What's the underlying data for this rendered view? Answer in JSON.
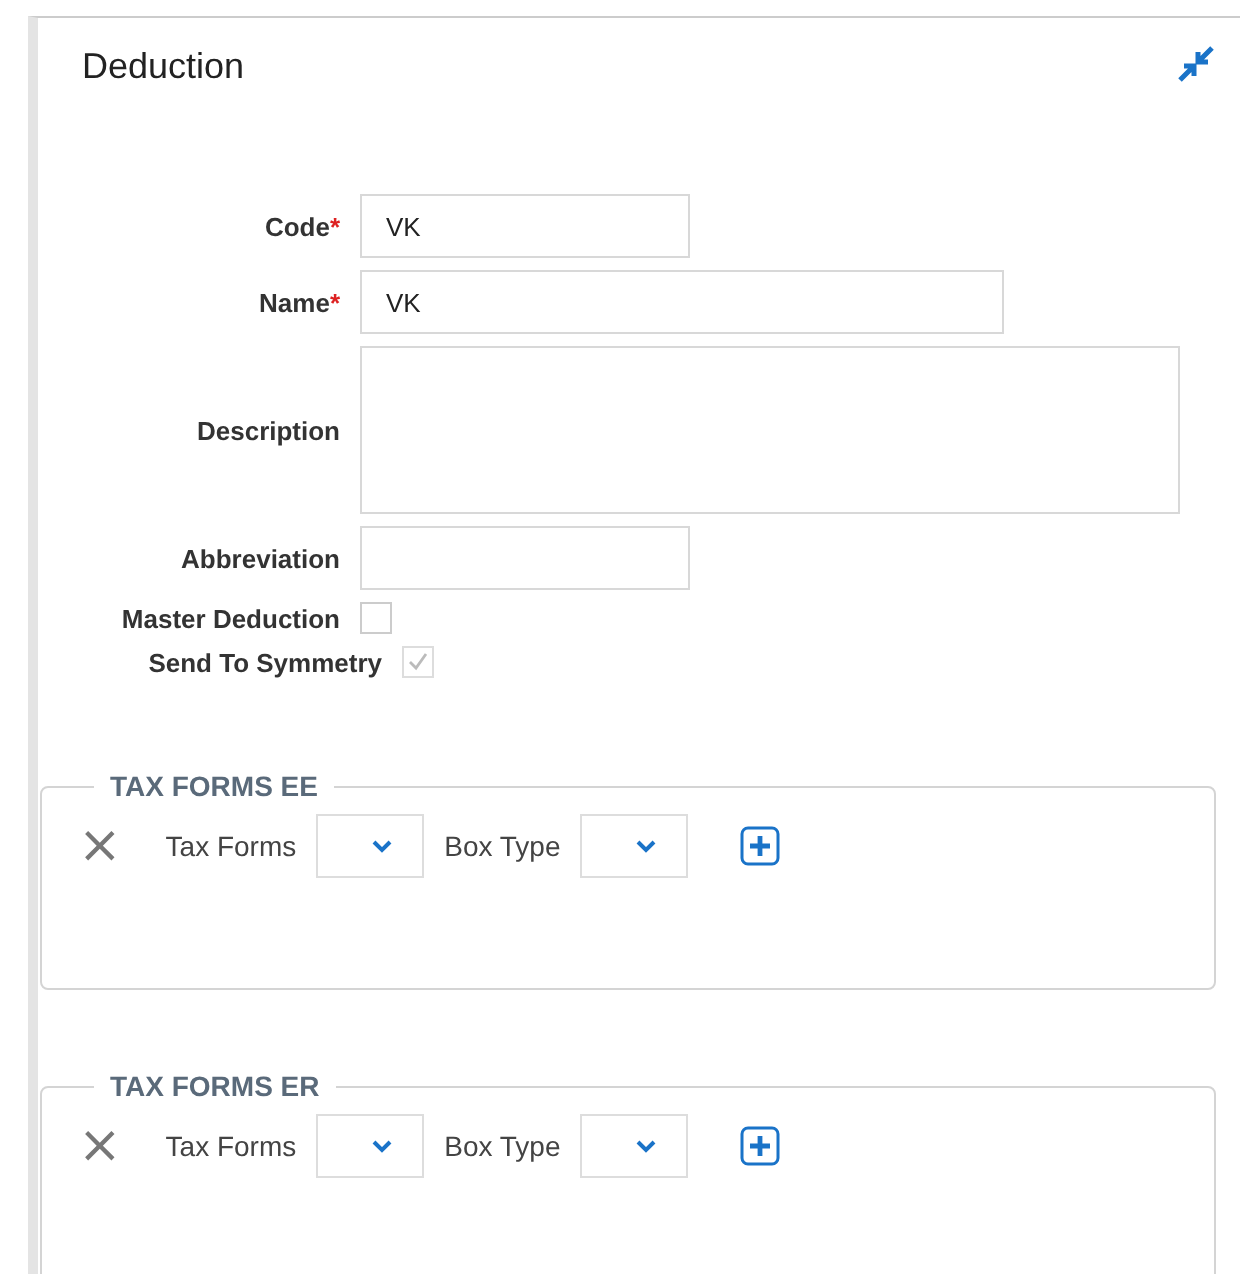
{
  "panel": {
    "title": "Deduction"
  },
  "fields": [
    {
      "kind": "text",
      "label": "Code",
      "required_mark": "*",
      "value": "VK"
    },
    {
      "kind": "text",
      "label": "Name",
      "required_mark": "*",
      "value": "VK"
    },
    {
      "kind": "textarea",
      "label": "Description"
    },
    {
      "kind": "text",
      "label": "Abbreviation"
    },
    {
      "kind": "checkbox",
      "label": "Master Deduction",
      "checked": false,
      "disabled": false
    },
    {
      "kind": "checkbox",
      "label": "Send To Symmetry",
      "checked": true,
      "disabled": true
    }
  ],
  "groups": [
    {
      "legend": "TAX FORMS EE",
      "rows": [
        {
          "remove": "×",
          "tax_forms_label": "Tax Forms",
          "box_type_label": "Box Type"
        }
      ]
    },
    {
      "legend": "TAX FORMS ER",
      "rows": [
        {
          "remove": "×",
          "tax_forms_label": "Tax Forms",
          "box_type_label": "Box Type"
        }
      ]
    }
  ]
}
